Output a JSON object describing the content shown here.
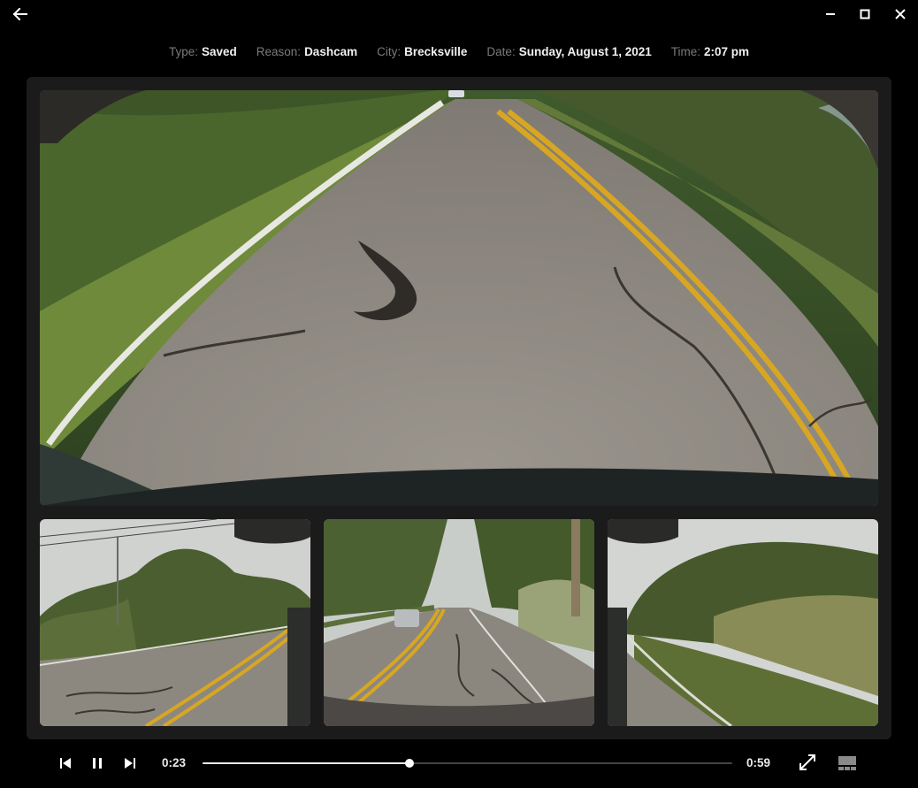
{
  "meta": [
    {
      "label": "Type:",
      "value": "Saved"
    },
    {
      "label": "Reason:",
      "value": "Dashcam"
    },
    {
      "label": "City:",
      "value": "Brecksville"
    },
    {
      "label": "Date:",
      "value": "Sunday, August 1, 2021"
    },
    {
      "label": "Time:",
      "value": "2:07 pm"
    }
  ],
  "icons": {
    "back": "arrow-left-icon",
    "minimize": "minimize-icon",
    "maximize": "maximize-icon",
    "close": "close-icon",
    "previous": "skip-previous-icon",
    "pause": "pause-icon",
    "next": "skip-next-icon",
    "fullscreen": "expand-icon",
    "layout": "grid-layout-icon"
  },
  "playback": {
    "current_time": "0:23",
    "total_time": "0:59",
    "progress": 0.39
  },
  "colors": {
    "background": "#000000",
    "panel": "#1b1b1b",
    "asphalt": "#8e8a84",
    "lane_yellow": "#d8a623",
    "foliage": "#4d6233"
  }
}
